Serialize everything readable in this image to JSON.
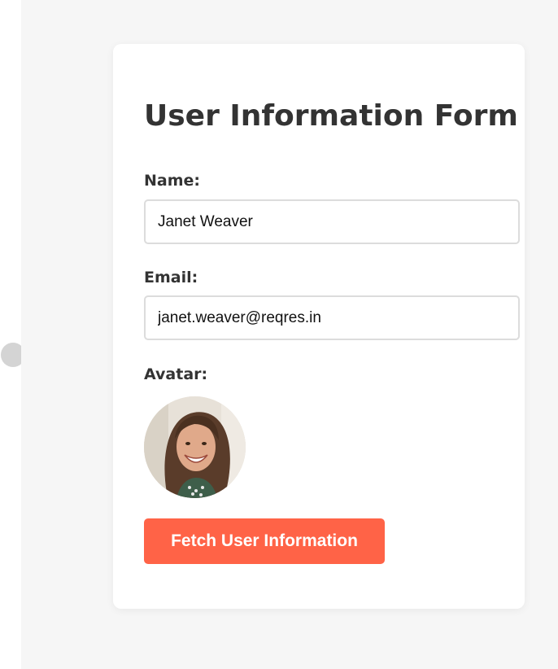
{
  "form": {
    "title": "User Information Form",
    "name_label": "Name:",
    "name_value": "Janet Weaver",
    "email_label": "Email:",
    "email_value": "janet.weaver@reqres.in",
    "avatar_label": "Avatar:",
    "avatar_alt": "Janet Weaver avatar",
    "fetch_button_label": "Fetch User Information"
  },
  "colors": {
    "page_background": "#f6f6f6",
    "card_background": "#ffffff",
    "text": "#333333",
    "button": "#ff6347",
    "button_text": "#ffffff",
    "input_border": "#dcdcdc"
  }
}
